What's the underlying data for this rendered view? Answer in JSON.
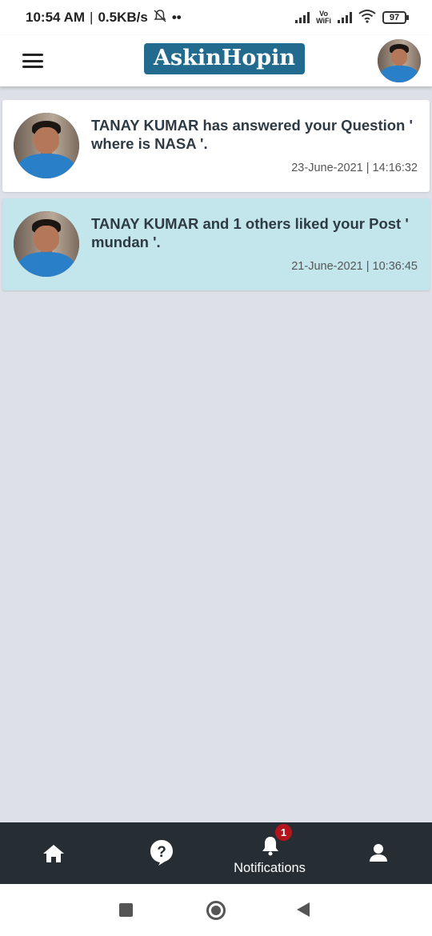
{
  "status_bar": {
    "time": "10:54 AM",
    "separator": "|",
    "speed": "0.5KB/s",
    "dots": "••",
    "vowifi_line1": "Vo",
    "vowifi_line2": "WiFi",
    "battery": "97"
  },
  "header": {
    "logo_text": "AskinHopin",
    "brand_color": "#236b8e"
  },
  "notifications": [
    {
      "text": "TANAY KUMAR has answered your Question ' where is NASA '.",
      "timestamp": "23-June-2021 | 14:16:32",
      "state": "read",
      "background": "#ffffff"
    },
    {
      "text": "TANAY KUMAR and 1 others liked your Post  ' mundan '.",
      "timestamp": "21-June-2021 | 10:36:45",
      "state": "unread",
      "background": "#c3e6ec"
    }
  ],
  "bottom_nav": {
    "items": [
      {
        "icon": "home-icon",
        "label": ""
      },
      {
        "icon": "question-bubble-icon",
        "label": ""
      },
      {
        "icon": "bell-icon",
        "label": "Notifications",
        "badge": "1"
      },
      {
        "icon": "person-icon",
        "label": ""
      }
    ],
    "background": "#262d33",
    "badge_color": "#b3151c"
  },
  "system_nav": {
    "buttons": [
      "recent-apps-icon",
      "home-circle-icon",
      "back-triangle-icon"
    ]
  }
}
